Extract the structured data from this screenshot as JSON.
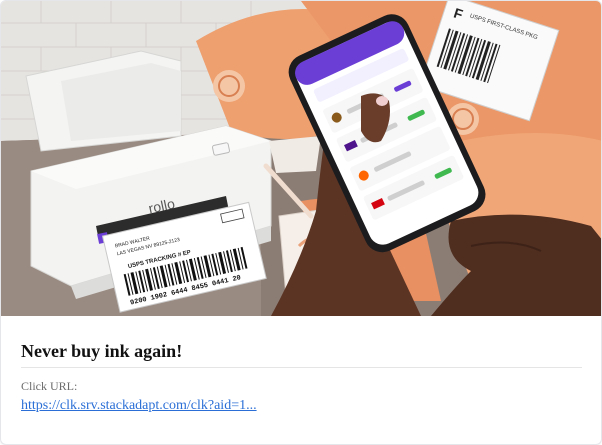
{
  "ad": {
    "headline": "Never buy ink again!",
    "click_url_label": "Click URL:",
    "click_url": "https://clk.srv.stackadapt.com/clk?aid=1..."
  },
  "image": {
    "printer_brand": "rollo",
    "label_recipient_lines": [
      "BRAD WALTER",
      "LAS VEGAS NV 89125-2123"
    ],
    "label_tracking_title": "USPS TRACKING # EP",
    "label_tracking_number": "9200 1902 6444 8455 0441 20",
    "package_label_title": "USPS FIRST-CLASS PKG",
    "colors": {
      "wall": "#e4e2df",
      "desk": "#8a7a72",
      "printer": "#f3f3f1",
      "envelope": "#ec9a6c",
      "phone_accent": "#6b3fd6",
      "skin": "#5b3424"
    }
  }
}
